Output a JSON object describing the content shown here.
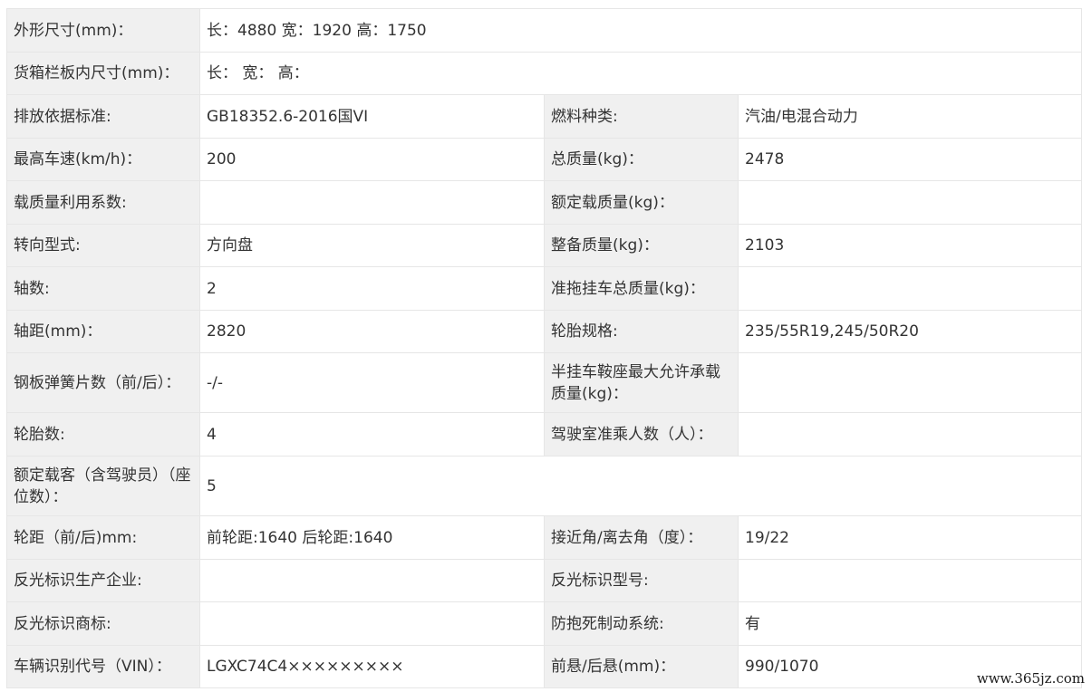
{
  "rows": [
    {
      "l1": "外形尺寸(mm)：",
      "v1": "长：4880 宽：1920 高：1750"
    },
    {
      "l1": "货箱栏板内尺寸(mm)：",
      "v1": "长：  宽：  高："
    },
    {
      "l1": "排放依据标准:",
      "v1": "GB18352.6-2016国VI",
      "l2": "燃料种类:",
      "v2": "汽油/电混合动力"
    },
    {
      "l1": "最高车速(km/h)：",
      "v1": "200",
      "l2": "总质量(kg)：",
      "v2": "2478"
    },
    {
      "l1": "载质量利用系数:",
      "v1": "",
      "l2": "额定载质量(kg)：",
      "v2": ""
    },
    {
      "l1": "转向型式:",
      "v1": "方向盘",
      "l2": "整备质量(kg)：",
      "v2": "2103"
    },
    {
      "l1": "轴数:",
      "v1": "2",
      "l2": "准拖挂车总质量(kg)：",
      "v2": ""
    },
    {
      "l1": "轴距(mm)：",
      "v1": "2820",
      "l2": "轮胎规格:",
      "v2": "235/55R19,245/50R20"
    },
    {
      "l1": "钢板弹簧片数（前/后）：",
      "v1": "-/-",
      "l2": "半挂车鞍座最大允许承载质量(kg)：",
      "v2": ""
    },
    {
      "l1": "轮胎数:",
      "v1": "4",
      "l2": "驾驶室准乘人数（人）：",
      "v2": ""
    },
    {
      "l1": "额定载客（含驾驶员）（座位数）：",
      "v1": "5"
    },
    {
      "l1": "轮距（前/后)mm:",
      "v1": "前轮距:1640 后轮距:1640",
      "l2": "接近角/离去角（度）：",
      "v2": "19/22"
    },
    {
      "l1": "反光标识生产企业:",
      "v1": "",
      "l2": "反光标识型号:",
      "v2": ""
    },
    {
      "l1": "反光标识商标:",
      "v1": "",
      "l2": "防抱死制动系统:",
      "v2": "有"
    },
    {
      "l1": "车辆识别代号（VIN）：",
      "v1": "LGXC74C4×××××××××",
      "l2": "前悬/后悬(mm)：",
      "v2": "990/1070"
    }
  ],
  "watermark": "www.365jz.com"
}
